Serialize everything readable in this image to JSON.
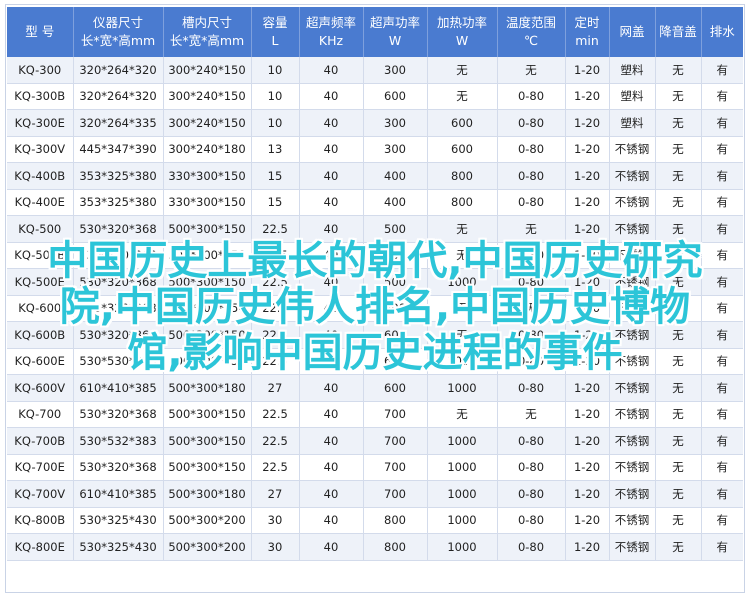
{
  "headers": [
    [
      "型 号",
      ""
    ],
    [
      "仪器尺寸",
      "长*宽*高mm"
    ],
    [
      "槽内尺寸",
      "长*宽*高mm"
    ],
    [
      "容量",
      "L"
    ],
    [
      "超声频率",
      "KHz"
    ],
    [
      "超声功率",
      "W"
    ],
    [
      "加热功率",
      "W"
    ],
    [
      "温度范围",
      "℃"
    ],
    [
      "定时",
      "min"
    ],
    [
      "网盖",
      ""
    ],
    [
      "降音盖",
      ""
    ],
    [
      "排水",
      ""
    ]
  ],
  "rows": [
    [
      "KQ-300",
      "320*264*320",
      "300*240*150",
      "10",
      "40",
      "300",
      "无",
      "无",
      "1-20",
      "塑料",
      "无",
      "有"
    ],
    [
      "KQ-300B",
      "320*264*320",
      "300*240*150",
      "10",
      "40",
      "600",
      "无",
      "0-80",
      "1-20",
      "塑料",
      "无",
      "有"
    ],
    [
      "KQ-300E",
      "320*264*335",
      "300*240*150",
      "10",
      "40",
      "300",
      "600",
      "0-80",
      "1-20",
      "塑料",
      "无",
      "有"
    ],
    [
      "KQ-300V",
      "445*347*390",
      "300*240*180",
      "13",
      "40",
      "300",
      "600",
      "0-80",
      "1-20",
      "不锈钢",
      "无",
      "有"
    ],
    [
      "KQ-400B",
      "353*325*380",
      "330*300*150",
      "15",
      "40",
      "400",
      "800",
      "0-80",
      "1-20",
      "不锈钢",
      "无",
      "有"
    ],
    [
      "KQ-400E",
      "353*325*380",
      "330*300*150",
      "15",
      "40",
      "400",
      "800",
      "0-80",
      "1-20",
      "不锈钢",
      "无",
      "有"
    ],
    [
      "KQ-500",
      "530*320*368",
      "500*300*150",
      "22.5",
      "40",
      "500",
      "无",
      "无",
      "1-20",
      "不锈钢",
      "无",
      "有"
    ],
    [
      "KQ-500B",
      "530*320*368",
      "500*300*150",
      "22.5",
      "40",
      "500",
      "无",
      "0-80",
      "1-20",
      "不锈钢",
      "无",
      "有"
    ],
    [
      "KQ-500E",
      "530*320*368",
      "500*300*150",
      "22.5",
      "40",
      "500",
      "1000",
      "0-80",
      "1-20",
      "不锈钢",
      "无",
      "有"
    ],
    [
      "KQ-600",
      "530*320*368",
      "500*300*150",
      "22.5",
      "40",
      "600",
      "无",
      "无",
      "1-20",
      "不锈钢",
      "无",
      "有"
    ],
    [
      "KQ-600B",
      "530*320*368",
      "500*300*150",
      "22.5",
      "40",
      "600",
      "无",
      "0-80",
      "1-20",
      "不锈钢",
      "无",
      "有"
    ],
    [
      "KQ-600E",
      "530*530*383",
      "500*300*150",
      "22.5",
      "40",
      "600",
      "1000",
      "0-80",
      "1-20",
      "不锈钢",
      "无",
      "有"
    ],
    [
      "KQ-600V",
      "610*410*385",
      "500*300*180",
      "27",
      "40",
      "600",
      "1000",
      "0-80",
      "1-20",
      "不锈钢",
      "无",
      "有"
    ],
    [
      "KQ-700",
      "530*320*368",
      "500*300*150",
      "22.5",
      "40",
      "700",
      "无",
      "无",
      "1-20",
      "不锈钢",
      "无",
      "有"
    ],
    [
      "KQ-700B",
      "530*532*383",
      "500*300*150",
      "22.5",
      "40",
      "700",
      "1000",
      "0-80",
      "1-20",
      "不锈钢",
      "无",
      "有"
    ],
    [
      "KQ-700E",
      "530*320*368",
      "500*300*150",
      "22.5",
      "40",
      "700",
      "1000",
      "0-80",
      "1-20",
      "不锈钢",
      "无",
      "有"
    ],
    [
      "KQ-700V",
      "610*410*385",
      "500*300*180",
      "27",
      "40",
      "700",
      "1000",
      "0-80",
      "1-20",
      "不锈钢",
      "无",
      "有"
    ],
    [
      "KQ-800B",
      "530*325*430",
      "500*300*200",
      "30",
      "40",
      "800",
      "1000",
      "0-80",
      "1-20",
      "不锈钢",
      "无",
      "有"
    ],
    [
      "KQ-800E",
      "530*325*430",
      "500*300*200",
      "30",
      "40",
      "800",
      "1000",
      "0-80",
      "1-20",
      "不锈钢",
      "无",
      "有"
    ]
  ],
  "overlay": {
    "line1": "中国历史上最长的朝代,中国历史研究",
    "line2": "院,中国历史伟人排名,中国历史博物",
    "line3": "馆,影响中国历史进程的事件"
  }
}
